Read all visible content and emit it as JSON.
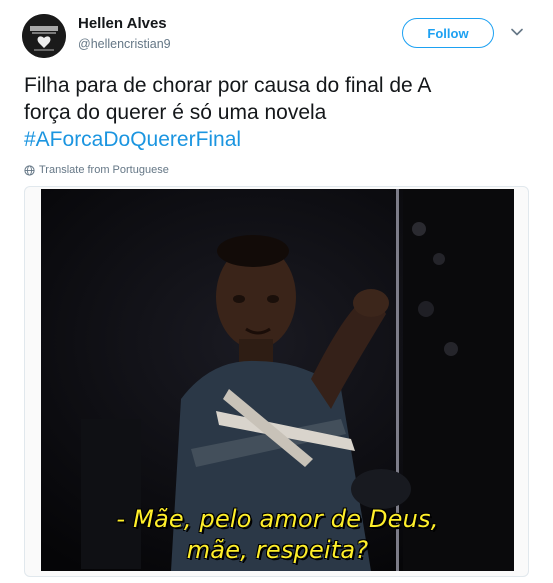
{
  "user": {
    "display_name": "Hellen Alves",
    "handle": "@hellencristian9"
  },
  "header": {
    "follow_label": "Follow",
    "menu_icon": "chevron-down-icon"
  },
  "tweet": {
    "text_line1": "Filha para de chorar por causa do final de A",
    "text_line2": "força do querer é só uma novela",
    "hashtag": "#AForcaDoQuererFinal",
    "translate_label": "Translate from Portuguese",
    "translate_icon": "globe-icon"
  },
  "media": {
    "subtitle_line1": "- Mãe, pelo amor de Deus,",
    "subtitle_line2": "mãe, respeita?"
  },
  "colors": {
    "accent": "#1da1f2",
    "hashtag": "#1b95e0",
    "muted": "#657786",
    "subtitle": "#ffef2a"
  }
}
